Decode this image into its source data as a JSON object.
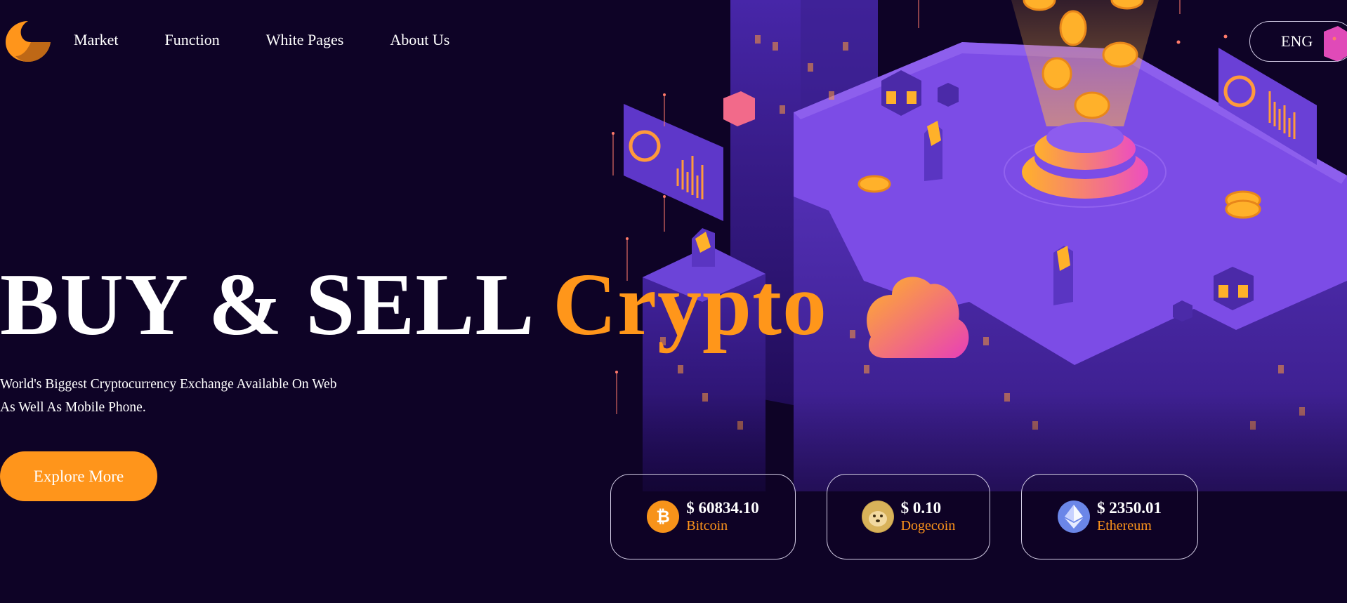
{
  "nav": {
    "items": [
      {
        "label": "Market"
      },
      {
        "label": "Function"
      },
      {
        "label": "White Pages"
      },
      {
        "label": "About Us"
      }
    ],
    "language": "ENG"
  },
  "hero": {
    "title_main": "BUY & SELL",
    "title_accent": "Crypto",
    "subtitle_line1": "World's Biggest Cryptocurrency Exchange Available On Web",
    "subtitle_line2": "As Well As Mobile Phone.",
    "cta_label": "Explore More"
  },
  "tickers": [
    {
      "price": "$ 60834.10",
      "name": "Bitcoin",
      "icon": "bitcoin-icon"
    },
    {
      "price": "$ 0.10",
      "name": "Dogecoin",
      "icon": "dogecoin-icon"
    },
    {
      "price": "$ 2350.01",
      "name": "Ethereum",
      "icon": "ethereum-icon"
    }
  ],
  "colors": {
    "background": "#0e0326",
    "accent": "#ff951b",
    "illustration_purple": "#6f3fd6"
  }
}
